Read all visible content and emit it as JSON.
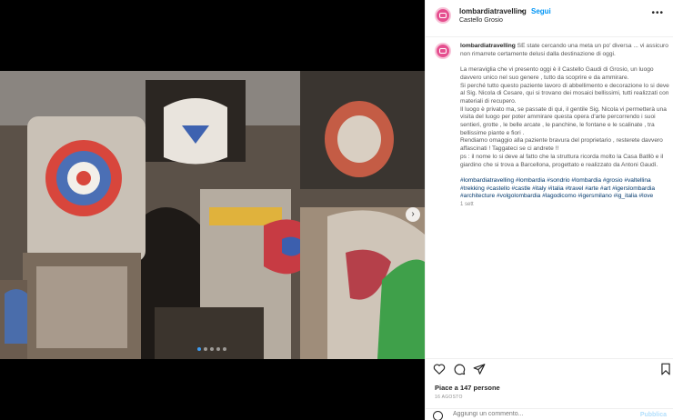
{
  "post": {
    "username": "lombardiatravelling",
    "separator": "•",
    "follow_label": "Segui",
    "location": "Castello Grosio",
    "more_label": "•••"
  },
  "media": {
    "image_alt": "Castello Gaudi di Grosio mosaic",
    "next_icon": "chevron-right-icon",
    "dots": 5,
    "active_dot": 1
  },
  "caption": {
    "username": "lombardiatravelling",
    "intro": "SE state cercando una meta un po' diversa ... vi assicuro non rimarrete certamente delusi dalla destinazione di oggi.",
    "para1": "La meraviglia che vi presento oggi è il Castello Gaudi di Grosio, un luogo davvero unico nel suo genere , tutto da scoprire e da ammirare.",
    "para2_lines": [
      "Si perché tutto questo paziente lavoro di abbellimento e decorazione lo si deve al Sig. Nicola di Cesare, qui si trovano dei mosaici bellissimi, tutti realizzati con materiali di recupero.",
      "Il luogo è privato ma, se passate di qui, il gentile Sig. Nicola vi permetterà una visita del luogo per poter ammirare questa opera d'arte percorrendo i suoi sentieri, grotte , le belle arcate , le panchine, le fontane e le scalinate , tra bellissime piante e fiori .",
      "Rendiamo omaggio alla paziente bravura del proprietario , resterete davvero affascinati ! Taggateci se ci andrete !!",
      "ps : il nome lo si deve al fatto che la struttura ricorda molto la Casa Batllò e il giardino che si trova a Barcellona, progettato e realizzato da Antoni Gaudì."
    ],
    "hashtags": "#lombardiatravelling #lombardia #sondrio #lombardia #grosio #valtellina #trekking #castello #castle #italy #italia #travel #arte #art #igerslombardia #architecture #volgolombardia #lagodicomo #igersmilano #ig_italia #love",
    "time": "1 sett"
  },
  "actions": {
    "like_icon": "heart-icon",
    "comment_icon": "comment-icon",
    "share_icon": "share-icon",
    "save_icon": "bookmark-icon",
    "likes_text": "Piace a 147 persone",
    "date_text": "16 AGOSTO",
    "comment_placeholder": "Aggiungi un commento...",
    "publish_label": "Pubblica",
    "emoji_icon": "emoji-icon"
  },
  "colors": {
    "accent": "#0095f6",
    "hashtag": "#00376b",
    "avatar": "#e54f8f"
  }
}
